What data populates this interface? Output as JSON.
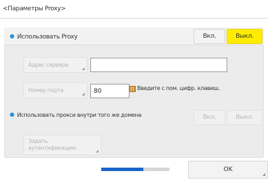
{
  "page": {
    "title": "<Параметры Proxy>"
  },
  "use_proxy": {
    "label": "Использовать Proxy",
    "on_label": "Вкл.",
    "off_label": "Выкл.",
    "selected": "off"
  },
  "server_address": {
    "button_label": "Адрес сервера",
    "value": ""
  },
  "port": {
    "button_label": "Номер порта",
    "value": "80",
    "hint": "Введите с пом. цифр. клавиш."
  },
  "same_domain": {
    "label": "Использовать прокси внутри того же домена",
    "on_label": "Вкл.",
    "off_label": "Выкл."
  },
  "auth": {
    "button_label": "Задать аутентификацию"
  },
  "footer": {
    "progress": 0.62,
    "ok_label": "OK"
  },
  "colors": {
    "accent": "#ffec00",
    "progress": "#1b63c8",
    "bullet": "#2d8fd8"
  }
}
